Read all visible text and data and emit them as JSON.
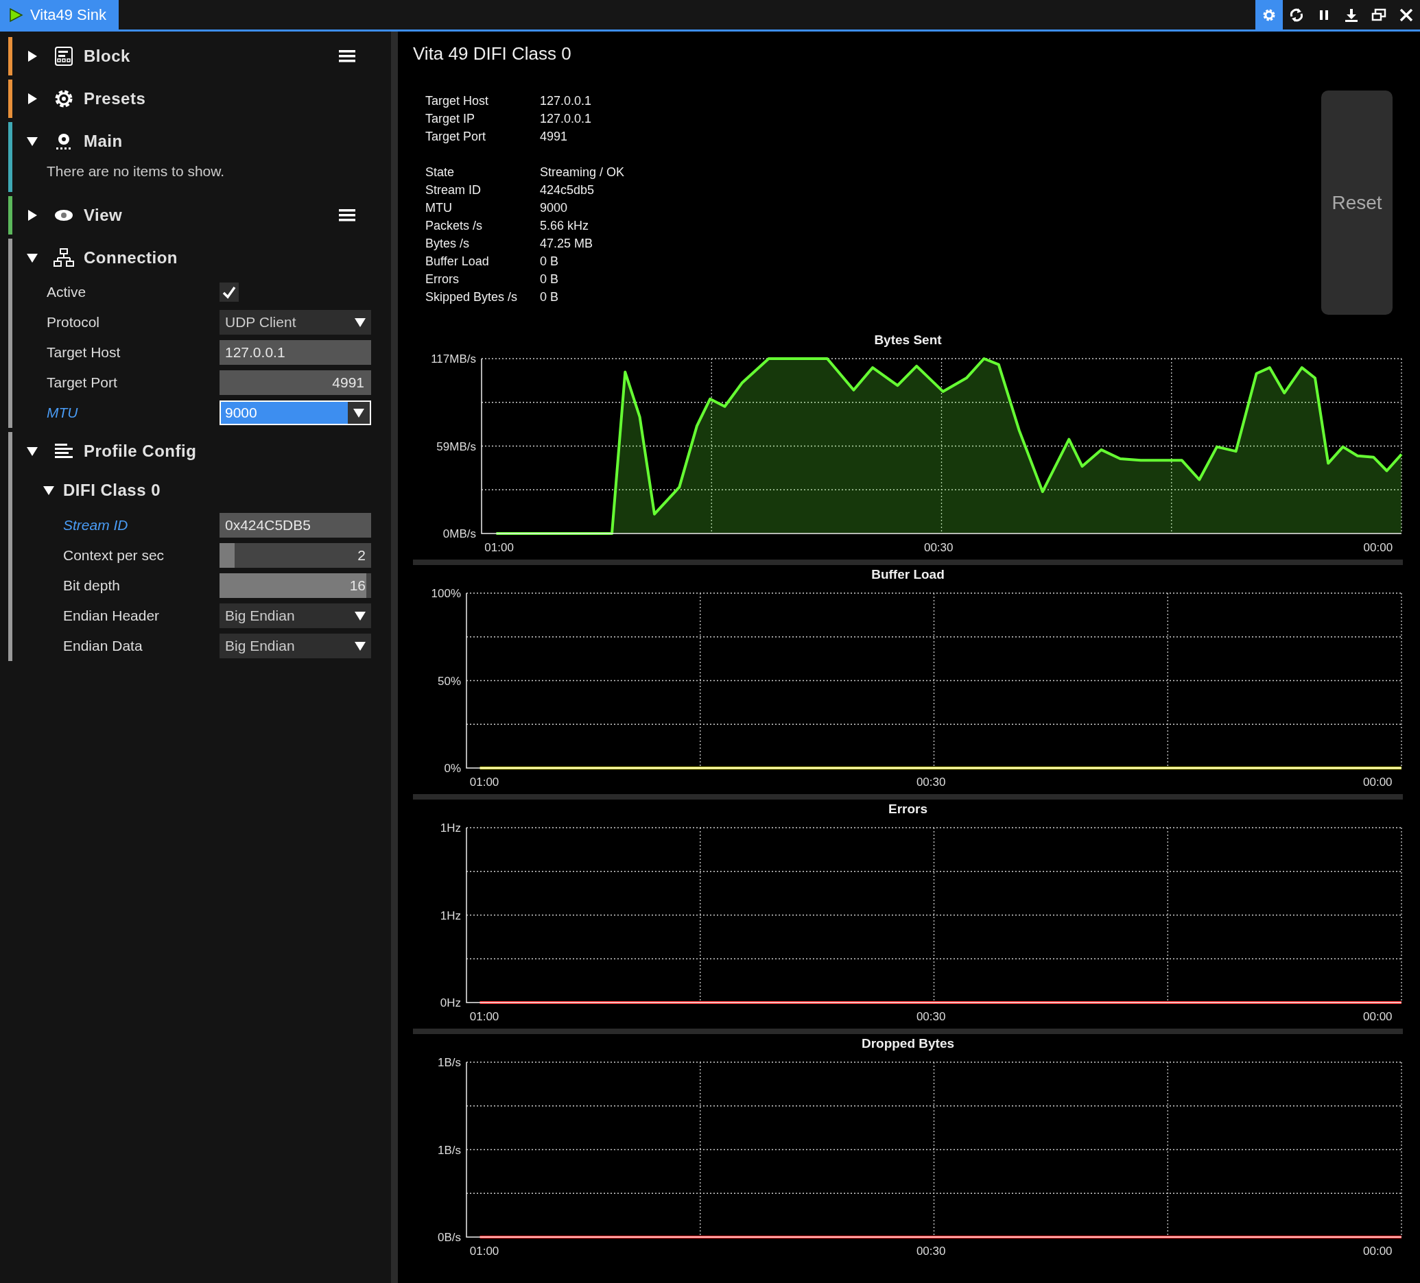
{
  "window": {
    "title": "Vita49 Sink"
  },
  "toolbar": [
    {
      "kind": "settings",
      "selected": true
    },
    {
      "kind": "refresh",
      "selected": false
    },
    {
      "kind": "pause",
      "selected": false
    },
    {
      "kind": "download",
      "selected": false
    },
    {
      "kind": "restore",
      "selected": false
    },
    {
      "kind": "close",
      "selected": false
    }
  ],
  "sidebar": {
    "sections": [
      {
        "title": "Block",
        "kind": "block",
        "color": "#e8903a",
        "expanded": false,
        "menu": true
      },
      {
        "title": "Presets",
        "kind": "presets",
        "color": "#e8903a",
        "expanded": false,
        "menu": false
      },
      {
        "title": "Main",
        "kind": "main",
        "color": "#3fa9b5",
        "expanded": true,
        "menu": false,
        "empty_message": "There are no items to show."
      },
      {
        "title": "View",
        "kind": "view",
        "color": "#5cb85c",
        "expanded": false,
        "menu": true
      },
      {
        "title": "Connection",
        "kind": "network",
        "color": "#9a9a9a",
        "expanded": true,
        "menu": false,
        "properties": [
          {
            "label": "Active",
            "kind": "checkbox",
            "checked": true,
            "modified": false
          },
          {
            "label": "Protocol",
            "kind": "dropdown",
            "value": "UDP Client",
            "modified": false,
            "focused": false
          },
          {
            "label": "Target Host",
            "kind": "text",
            "value": "127.0.0.1",
            "modified": false
          },
          {
            "label": "Target Port",
            "kind": "number",
            "value": "4991",
            "modified": false
          },
          {
            "label": "MTU",
            "kind": "dropdown",
            "value": "9000",
            "modified": true,
            "focused": true
          }
        ]
      },
      {
        "title": "Profile Config",
        "kind": "lines",
        "color": "#9a9a9a",
        "expanded": true,
        "menu": false,
        "children": [
          {
            "title": "DIFI Class 0",
            "expanded": true,
            "properties": [
              {
                "label": "Stream ID",
                "kind": "text",
                "value": "0x424C5DB5",
                "modified": true
              },
              {
                "label": "Context per sec",
                "kind": "slider",
                "value": "2",
                "level": 0.1,
                "modified": false
              },
              {
                "label": "Bit depth",
                "kind": "slider",
                "value": "16",
                "level": 0.97,
                "modified": false
              },
              {
                "label": "Endian Header",
                "kind": "dropdown",
                "value": "Big Endian",
                "modified": false,
                "focused": false
              },
              {
                "label": "Endian Data",
                "kind": "dropdown",
                "value": "Big Endian",
                "modified": false,
                "focused": false
              }
            ]
          }
        ]
      }
    ]
  },
  "panel": {
    "title": "Vita 49 DIFI Class 0",
    "info_groups": [
      {
        "rows": [
          {
            "label": "Target Host",
            "value": "127.0.0.1"
          },
          {
            "label": "Target IP",
            "value": "127.0.0.1"
          },
          {
            "label": "Target Port",
            "value": "4991"
          }
        ]
      },
      {
        "rows": [
          {
            "label": "State",
            "value": "Streaming / OK"
          },
          {
            "label": "Stream ID",
            "value": "424c5db5"
          },
          {
            "label": "MTU",
            "value": "9000"
          },
          {
            "label": "Packets /s",
            "value": "5.66 kHz"
          },
          {
            "label": "Bytes /s",
            "value": "47.25 MB"
          },
          {
            "label": "Buffer Load",
            "value": "0 B"
          },
          {
            "label": "Errors",
            "value": "0 B"
          },
          {
            "label": "Skipped Bytes /s",
            "value": "0 B"
          }
        ]
      }
    ],
    "reset_button": "Reset",
    "charts": [
      {
        "chart_data": {
          "type": "area",
          "title": "Bytes Sent",
          "x": [
            60.2,
            52.3,
            51.4,
            50.4,
            49.4,
            47.7,
            46.5,
            45.6,
            44.6,
            43.4,
            41.6,
            37.6,
            35.8,
            34.5,
            32.8,
            31.5,
            29.7,
            28.1,
            26.9,
            25.9,
            24.5,
            22.9,
            21.1,
            20.2,
            18.9,
            17.6,
            16.2,
            13.4,
            12.2,
            11,
            9.7,
            8.3,
            7.4,
            6.4,
            5.2,
            4.3,
            3.4,
            2.4,
            1.4,
            0.3,
            -0.6,
            -1.6
          ],
          "xlim": [
            61.2,
            -1.6
          ],
          "ylim": [
            0,
            117
          ],
          "xticks": [
            {
              "value": 60,
              "label": "01:00"
            },
            {
              "value": 30,
              "label": "00:30"
            },
            {
              "value": 0,
              "label": "00:00"
            }
          ],
          "yticks": [
            {
              "value": 0,
              "label": "0MB/s"
            },
            {
              "value": 58.5,
              "label": "59MB/s"
            },
            {
              "value": 117,
              "label": "117MB/s"
            }
          ],
          "series": [
            {
              "color": "#66ff33",
              "values": [
                0,
                0,
                108,
                78,
                13,
                31,
                72,
                90,
                85,
                101,
                117,
                117,
                96,
                111,
                99,
                112,
                95,
                104,
                117,
                113,
                69,
                28,
                63,
                45,
                56,
                50,
                49,
                49,
                36,
                58,
                55,
                107,
                111,
                94,
                111,
                104,
                47,
                58,
                52,
                51,
                42,
                53
              ]
            }
          ]
        }
      },
      {
        "chart_data": {
          "type": "line",
          "title": "Buffer Load",
          "x": [
            60.3,
            -1.6
          ],
          "xlim": [
            61.2,
            -1.6
          ],
          "ylim": [
            0,
            100
          ],
          "xticks": [
            {
              "value": 60,
              "label": "01:00"
            },
            {
              "value": 30,
              "label": "00:30"
            },
            {
              "value": 0,
              "label": "00:00"
            }
          ],
          "yticks": [
            {
              "value": 0,
              "label": "0%"
            },
            {
              "value": 50,
              "label": "50%"
            },
            {
              "value": 100,
              "label": "100%"
            }
          ],
          "series": [
            {
              "color": "#e6e62e",
              "values": [
                0,
                0
              ]
            }
          ]
        }
      },
      {
        "chart_data": {
          "type": "line",
          "title": "Errors",
          "x": [
            60.3,
            -1.6
          ],
          "xlim": [
            61.2,
            -1.6
          ],
          "ylim": [
            0,
            1
          ],
          "xticks": [
            {
              "value": 60,
              "label": "01:00"
            },
            {
              "value": 30,
              "label": "00:30"
            },
            {
              "value": 0,
              "label": "00:00"
            }
          ],
          "yticks": [
            {
              "value": 0,
              "label": "0Hz"
            },
            {
              "value": 0.5,
              "label": "1Hz"
            },
            {
              "value": 1,
              "label": "1Hz"
            }
          ],
          "series": [
            {
              "color": "#ff2a2a",
              "values": [
                0,
                0
              ]
            }
          ]
        }
      },
      {
        "chart_data": {
          "type": "line",
          "title": "Dropped Bytes",
          "x": [
            60.3,
            -1.6
          ],
          "xlim": [
            61.2,
            -1.6
          ],
          "ylim": [
            0,
            1
          ],
          "xticks": [
            {
              "value": 60,
              "label": "01:00"
            },
            {
              "value": 30,
              "label": "00:30"
            },
            {
              "value": 0,
              "label": "00:00"
            }
          ],
          "yticks": [
            {
              "value": 0,
              "label": "0B/s"
            },
            {
              "value": 0.5,
              "label": "1B/s"
            },
            {
              "value": 1,
              "label": "1B/s"
            }
          ],
          "series": [
            {
              "color": "#ff2a2a",
              "values": [
                0,
                0
              ]
            }
          ]
        }
      }
    ]
  }
}
